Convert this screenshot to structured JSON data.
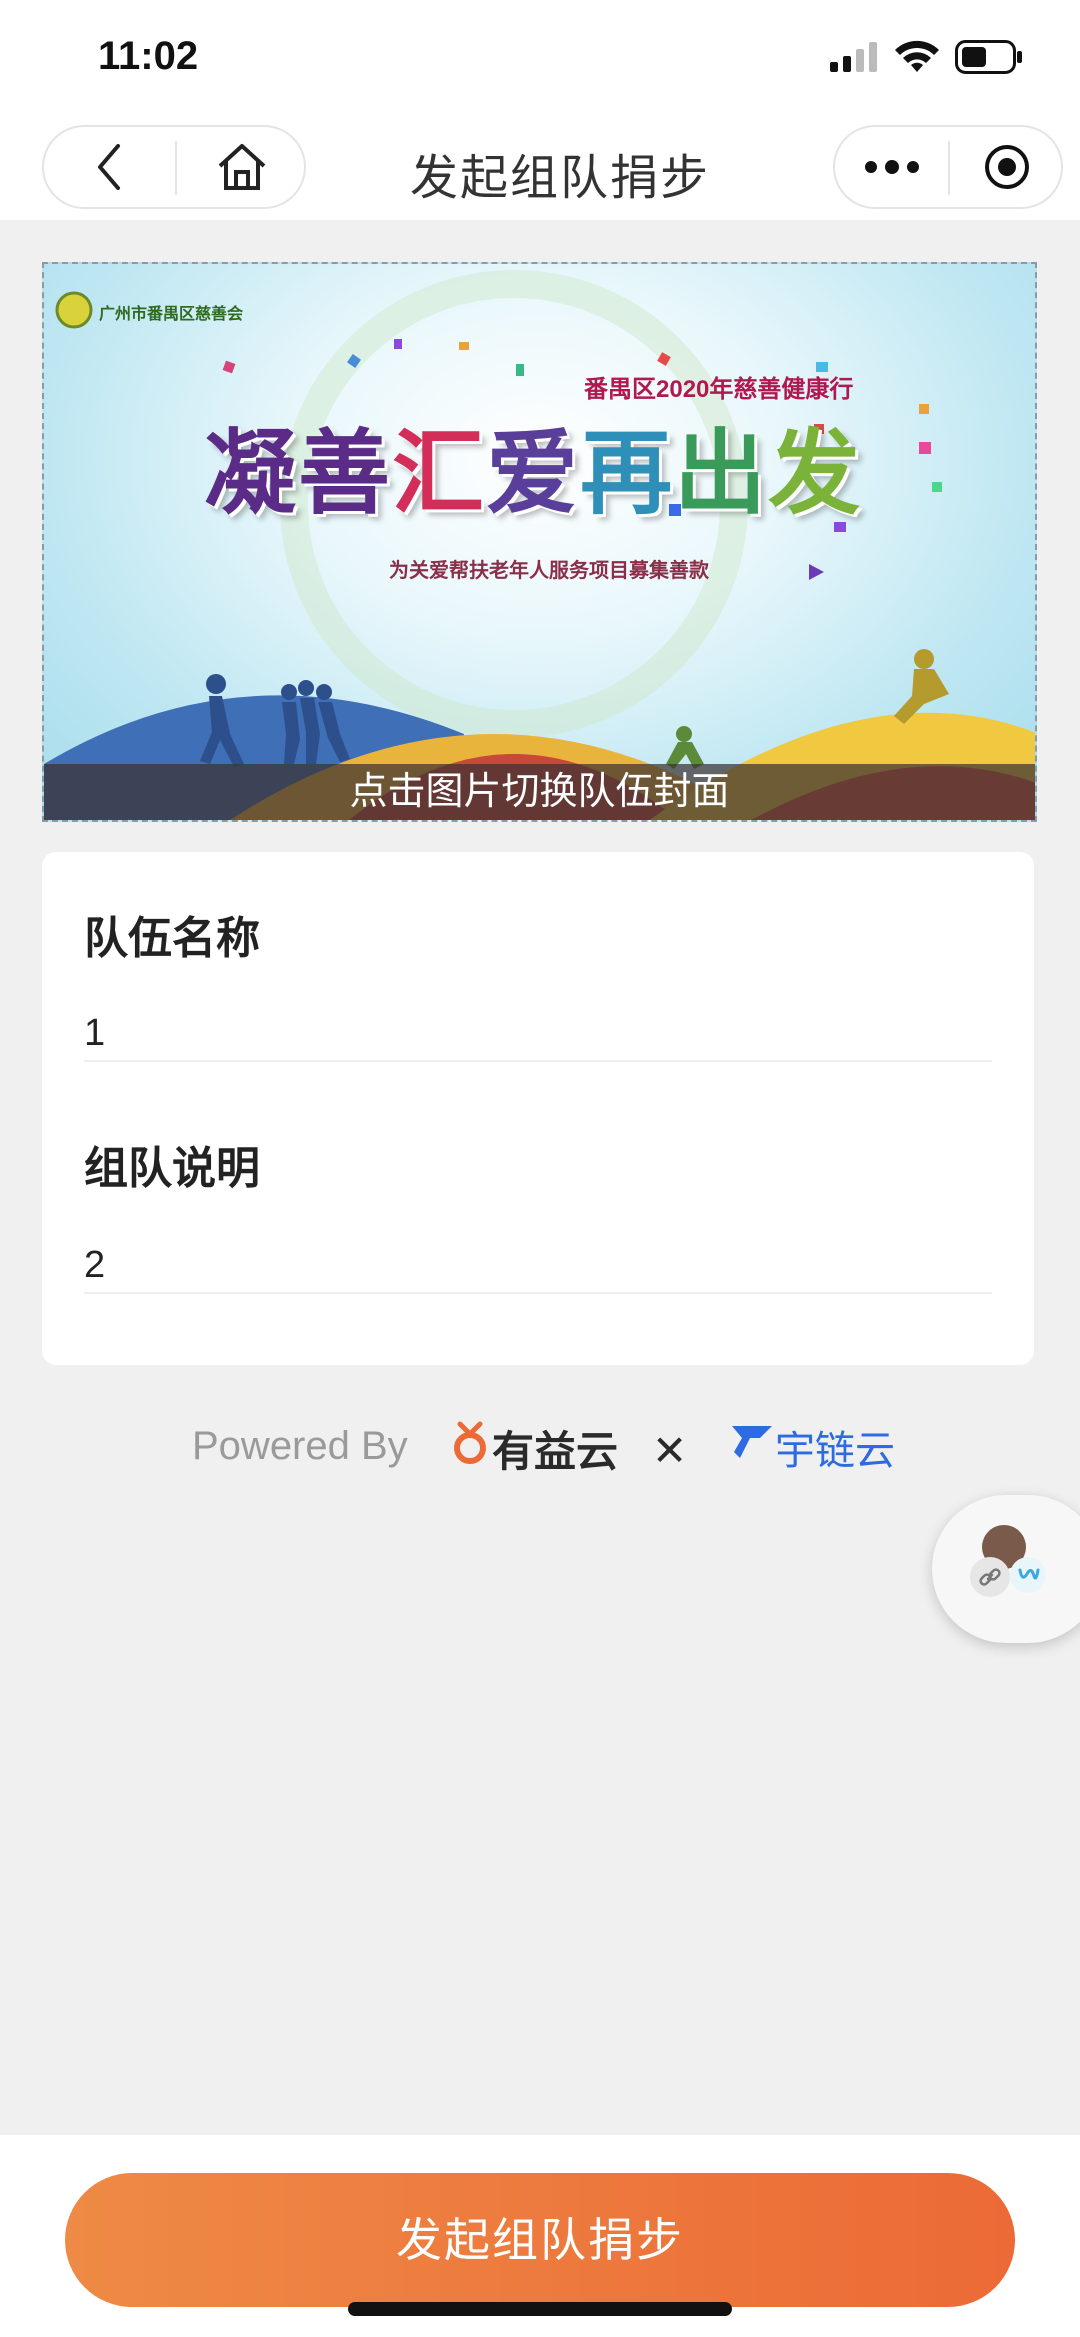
{
  "status_bar": {
    "time": "11:02"
  },
  "nav": {
    "title": "发起组队捐步"
  },
  "banner": {
    "org": "广州市番禺区慈善会",
    "subtitle": "番禺区2020年慈善健康行",
    "title_chars": [
      "凝",
      "善",
      "汇",
      "爱",
      "再",
      "出",
      "发"
    ],
    "description": "为关爱帮扶老年人服务项目募集善款",
    "caption": "点击图片切换队伍封面"
  },
  "form": {
    "team_name_label": "队伍名称",
    "team_name_value": "1",
    "team_desc_label": "组队说明",
    "team_desc_value": "2"
  },
  "powered": {
    "prefix": "Powered By",
    "brand1": "有益云",
    "separator": "✕",
    "brand2": "宇链云"
  },
  "submit": {
    "label": "发起组队捐步"
  },
  "colors": {
    "accent_start": "#ee8a45",
    "accent_end": "#ec6a36",
    "link_blue": "#2f6be0"
  }
}
